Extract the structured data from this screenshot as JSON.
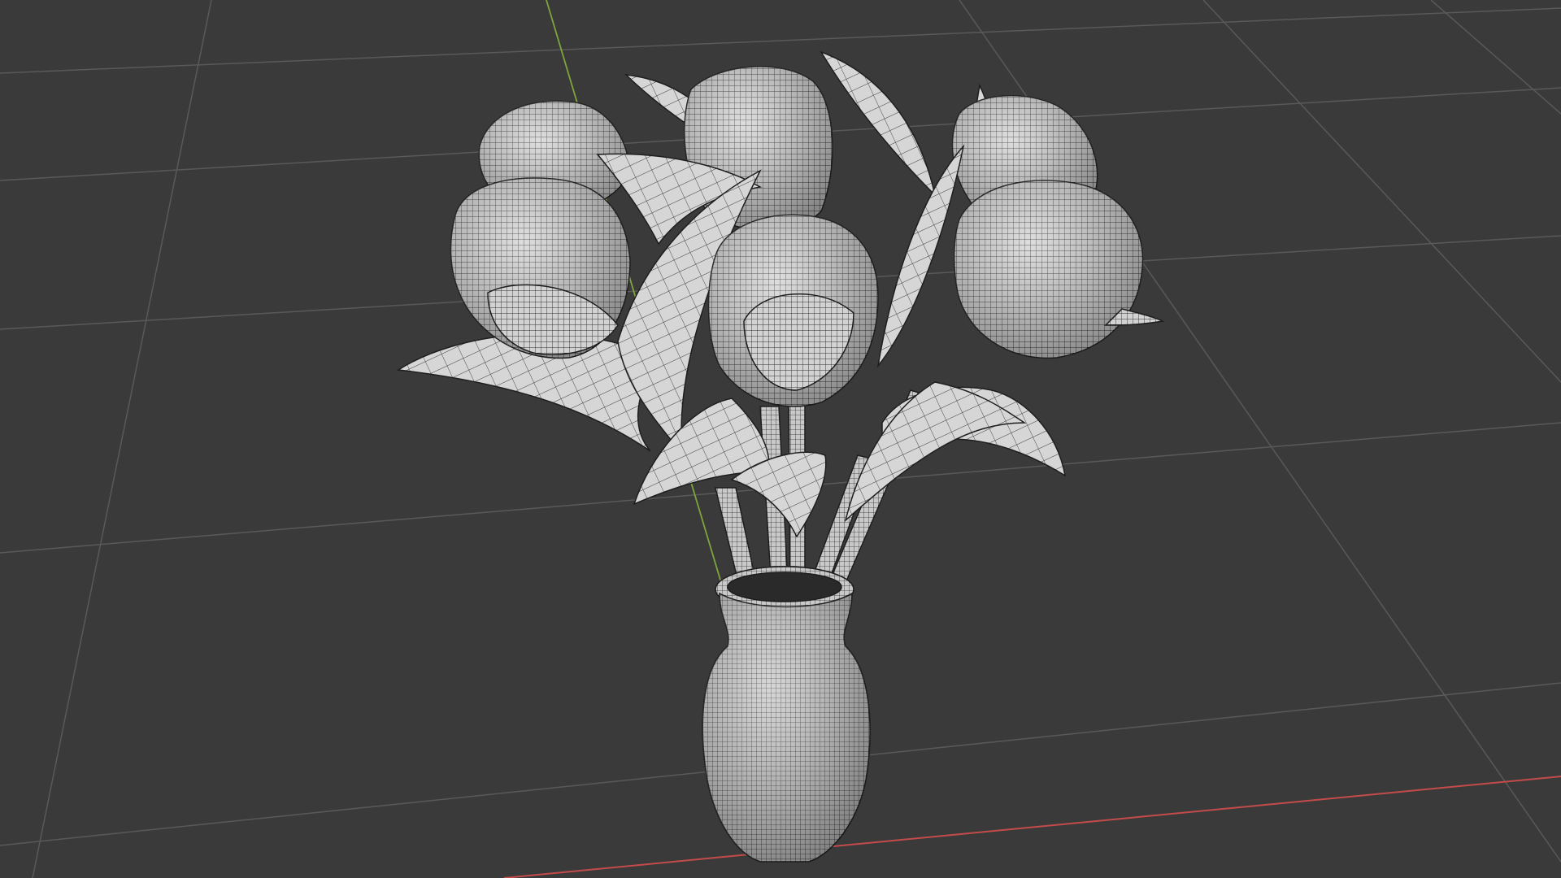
{
  "viewport": {
    "mode": "wireframe-shaded",
    "background_color": "#3a3a3a",
    "grid_color": "#5b5b5b",
    "x_axis_color": "#c44b4b",
    "y_axis_color": "#7fa63a",
    "mesh_fill_color": "#cfcfcf",
    "mesh_wire_color": "#2a2a2a"
  },
  "scene": {
    "objects": [
      {
        "name": "vase",
        "icon": "vase-icon"
      },
      {
        "name": "tulip-bouquet",
        "icon": "flower-icon"
      }
    ]
  }
}
